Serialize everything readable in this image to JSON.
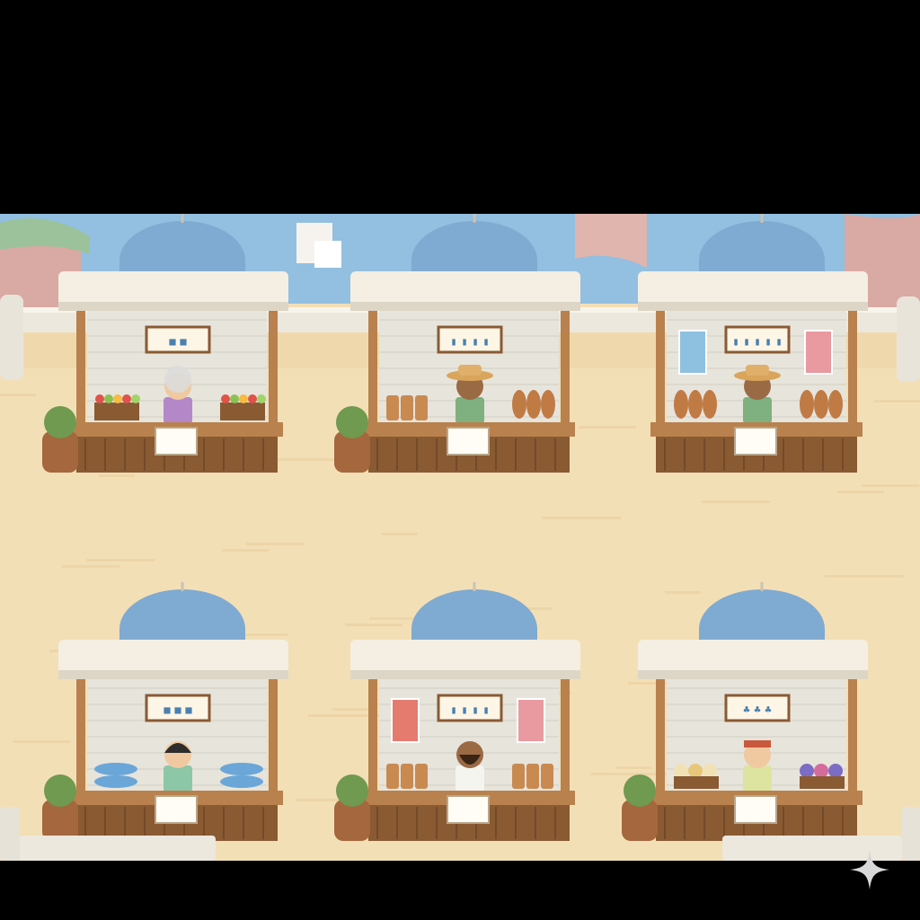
{
  "scene": {
    "colors": {
      "sand": "#f3dfb6",
      "sand_dark": "#e9cf9f",
      "wall": "#e7e4dc",
      "roof": "#f4efe2",
      "dome": "#7faad2",
      "wood": "#b9814d",
      "wood_dark": "#8a5a33",
      "sea": "#93bfe0",
      "cliff": "#d9a9a3"
    },
    "background": {
      "elements": [
        "sea",
        "pink-cliffs",
        "white-houses",
        "railing"
      ]
    },
    "stalls": [
      {
        "row": "top",
        "col": 0,
        "goods": [
          "fruit-crate",
          "fruit-crate"
        ],
        "vendor": "elderly-woman",
        "sign_glyphs": [
          "■",
          "■"
        ],
        "banners": [],
        "plant": true
      },
      {
        "row": "top",
        "col": 1,
        "goods": [
          "bread-stack",
          "clay-jars"
        ],
        "vendor": "man-straw-hat",
        "sign_glyphs": [
          "▮",
          "▮",
          "▮",
          "▮"
        ],
        "banners": [],
        "plant": true
      },
      {
        "row": "top",
        "col": 2,
        "goods": [
          "clay-jars",
          "clay-jars"
        ],
        "vendor": "man-straw-hat",
        "sign_glyphs": [
          "▮",
          "▮",
          "▮",
          "▮",
          "▮"
        ],
        "banners": [
          "blue",
          "pink"
        ],
        "plant": false
      },
      {
        "row": "bottom",
        "col": 0,
        "goods": [
          "fish",
          "fish"
        ],
        "vendor": "woman-dark-hair",
        "sign_glyphs": [
          "■",
          "■",
          "■"
        ],
        "banners": [],
        "plant": true
      },
      {
        "row": "bottom",
        "col": 1,
        "goods": [
          "bread-stack",
          "sacks"
        ],
        "vendor": "bearded-man",
        "sign_glyphs": [
          "▮",
          "▮",
          "▮",
          "▮"
        ],
        "banners": [
          "red-striped",
          "pink"
        ],
        "plant": true
      },
      {
        "row": "bottom",
        "col": 2,
        "goods": [
          "flower-baskets",
          "flower-pots"
        ],
        "vendor": "man-bandana",
        "sign_glyphs": [
          "♣",
          "♣",
          "♣"
        ],
        "banners": [],
        "plant": true
      }
    ]
  },
  "overlay": {
    "corner_icon": "sparkle-icon"
  }
}
